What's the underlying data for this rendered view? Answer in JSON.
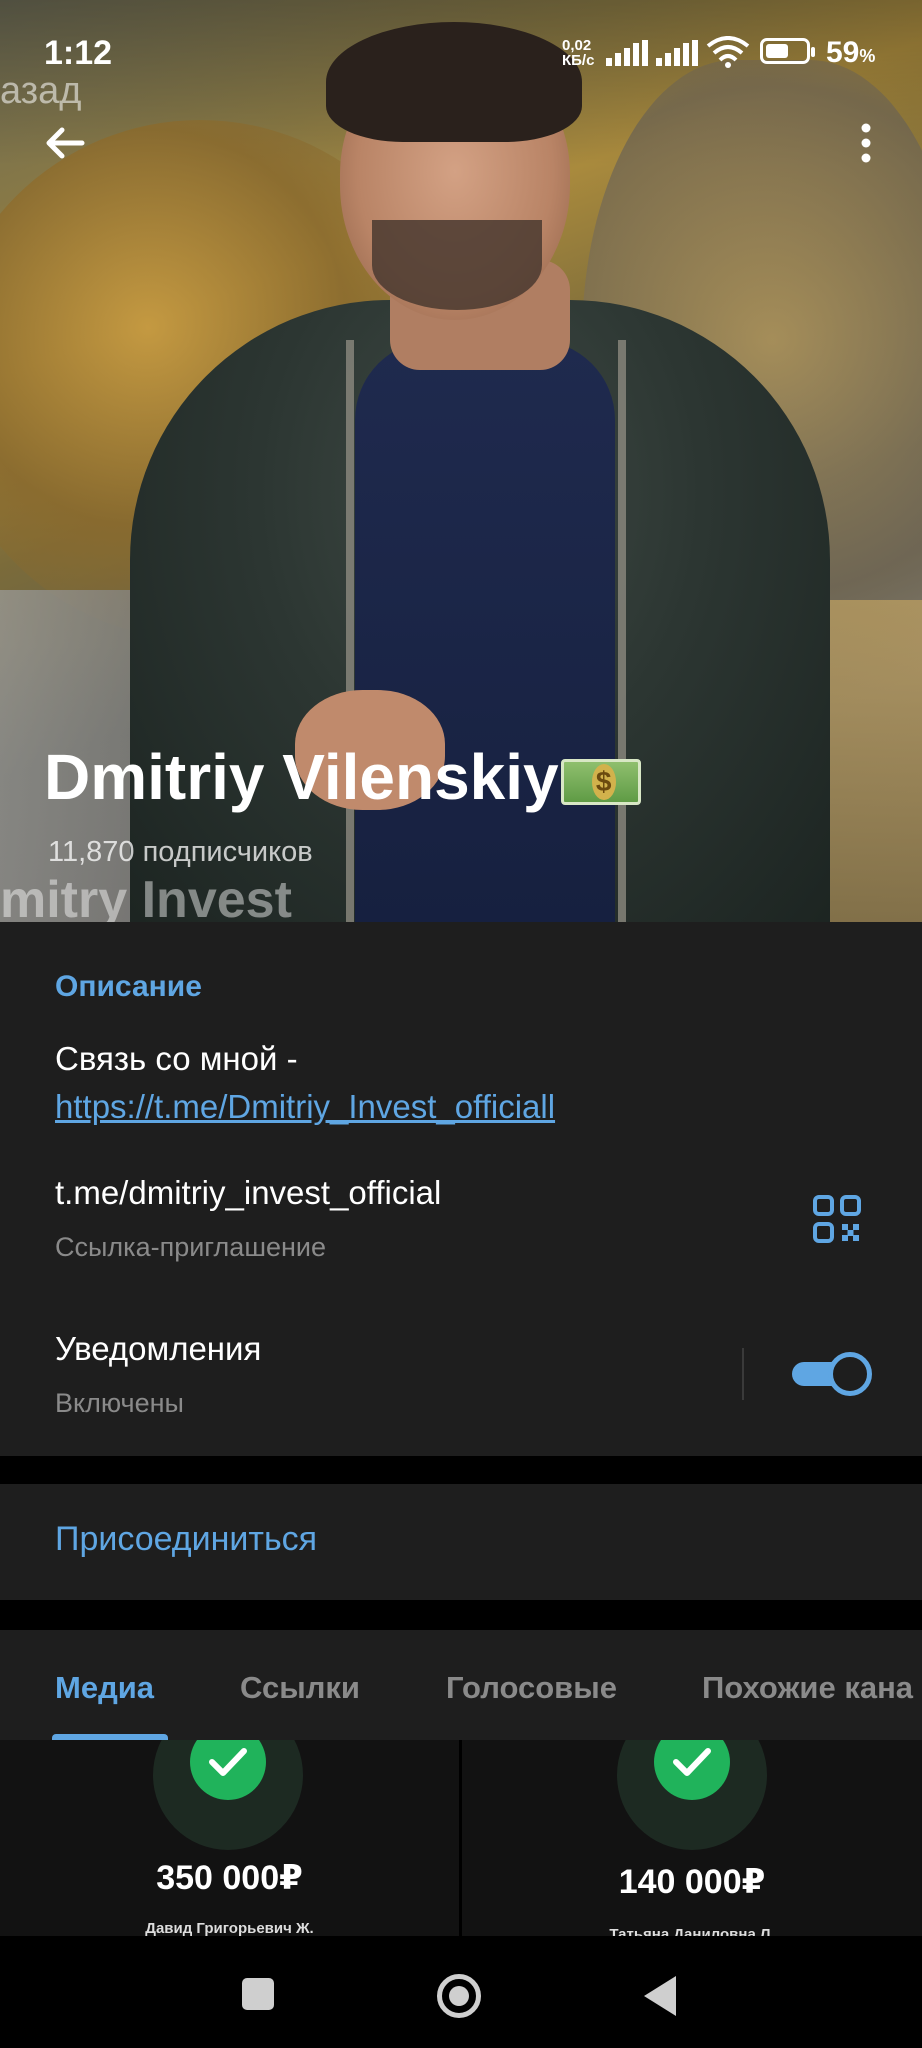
{
  "status_bar": {
    "time": "1:12",
    "net_speed_value": "0,02",
    "net_speed_unit": "КБ/с",
    "battery_percent": "59",
    "battery_percent_sign": "%",
    "battery_level": 0.59
  },
  "header": {
    "overlay_top_text": "азад",
    "channel_name": "Dmitriy Vilenskiy",
    "channel_name_emoji": "money-with-wings-icon",
    "subscribers": "11,870 подписчиков",
    "watermark": "mitry Invest"
  },
  "info": {
    "description_title": "Описание",
    "description_text": "Связь со мной -",
    "description_link": "https://t.me/Dmitriy_Invest_officiall",
    "invite_link": "t.me/dmitriy_invest_official",
    "invite_link_label": "Ссылка-приглашение",
    "notifications_title": "Уведомления",
    "notifications_status": "Включены",
    "notifications_enabled": true
  },
  "join": {
    "label": "Присоединиться"
  },
  "tabs": [
    {
      "label": "Медиа",
      "active": true
    },
    {
      "label": "Ссылки",
      "active": false
    },
    {
      "label": "Голосовые",
      "active": false
    },
    {
      "label": "Похожие кана",
      "active": false
    }
  ],
  "media": [
    {
      "amount": "350 000₽",
      "payer": "Давид Григорьевич Ж."
    },
    {
      "amount": "140 000₽",
      "payer": "Татьяна Даниловна Л."
    }
  ],
  "colors": {
    "accent": "#5fa6e3",
    "card_bg": "#1e1e1e",
    "check_green": "#20b35b"
  }
}
